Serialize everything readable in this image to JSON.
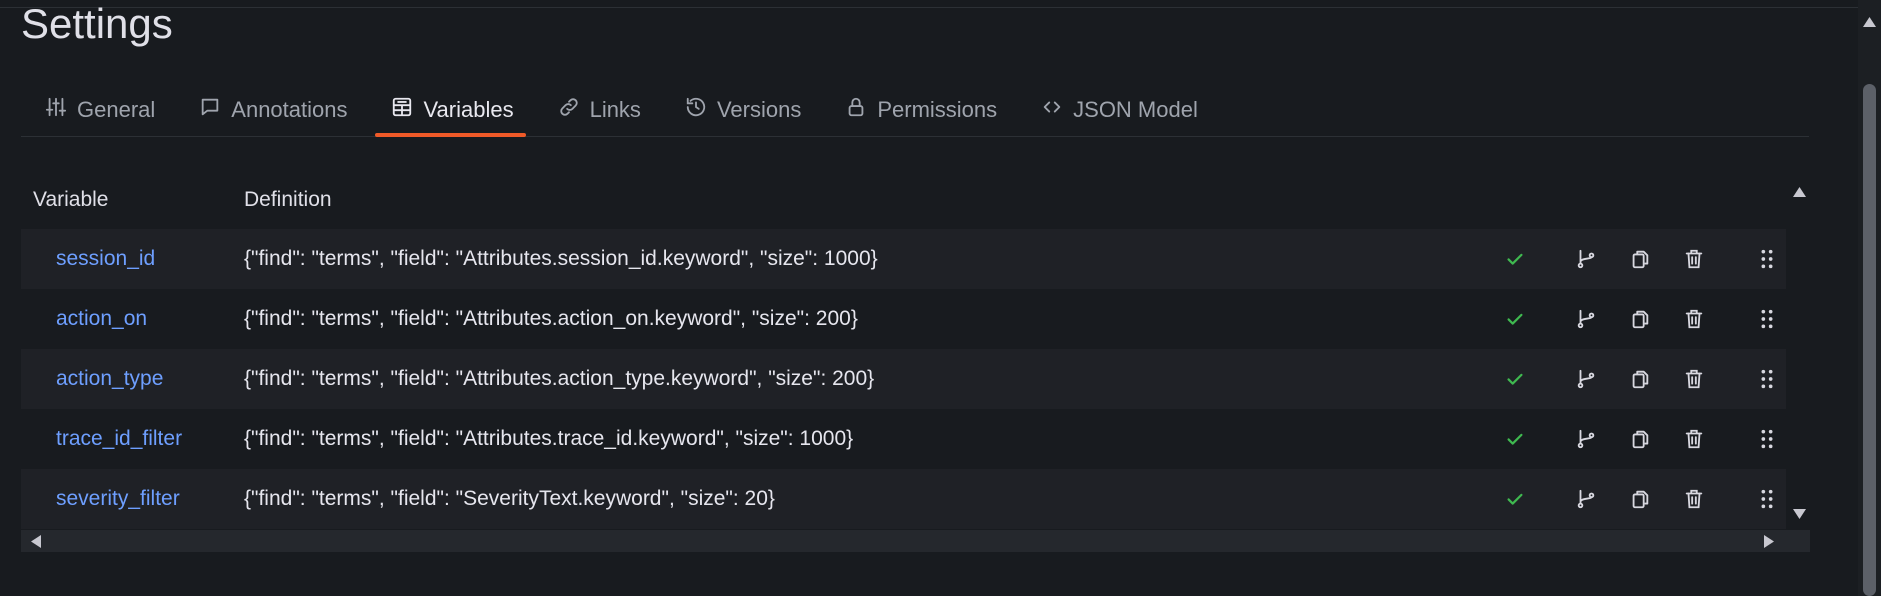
{
  "page": {
    "title": "Settings"
  },
  "tabs": [
    {
      "label": "General",
      "icon": "sliders-icon"
    },
    {
      "label": "Annotations",
      "icon": "comment-icon"
    },
    {
      "label": "Variables",
      "icon": "calculator-icon",
      "active": true
    },
    {
      "label": "Links",
      "icon": "link-icon"
    },
    {
      "label": "Versions",
      "icon": "history-icon"
    },
    {
      "label": "Permissions",
      "icon": "lock-icon"
    },
    {
      "label": "JSON Model",
      "icon": "code-icon"
    }
  ],
  "table": {
    "headers": {
      "variable": "Variable",
      "definition": "Definition"
    },
    "rows": [
      {
        "name": "session_id",
        "definition": "{\"find\": \"terms\", \"field\": \"Attributes.session_id.keyword\", \"size\": 1000}"
      },
      {
        "name": "action_on",
        "definition": "{\"find\": \"terms\", \"field\": \"Attributes.action_on.keyword\", \"size\": 200}"
      },
      {
        "name": "action_type",
        "definition": "{\"find\": \"terms\", \"field\": \"Attributes.action_type.keyword\", \"size\": 200}"
      },
      {
        "name": "trace_id_filter",
        "definition": "{\"find\": \"terms\", \"field\": \"Attributes.trace_id.keyword\", \"size\": 1000}"
      },
      {
        "name": "severity_filter",
        "definition": "{\"find\": \"terms\", \"field\": \"SeverityText.keyword\", \"size\": 20}"
      }
    ]
  },
  "colors": {
    "background": "#181b1f",
    "accent": "#f05a28",
    "link": "#6e9fff",
    "ok": "#3fb950"
  }
}
